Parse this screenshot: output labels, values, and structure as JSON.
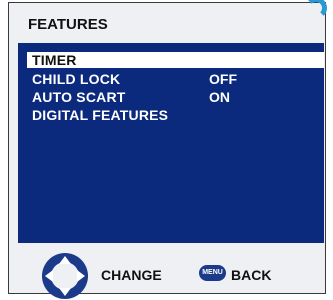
{
  "header": {
    "title": "FEATURES"
  },
  "menu": {
    "items": [
      {
        "label": "TIMER",
        "value": ""
      },
      {
        "label": "CHILD LOCK",
        "value": "OFF"
      },
      {
        "label": "AUTO SCART",
        "value": "ON"
      },
      {
        "label": "DIGITAL FEATURES",
        "value": ""
      }
    ],
    "selected_index": 0
  },
  "footer": {
    "change_label": "CHANGE",
    "menu_button_label": "MENU",
    "back_label": "BACK"
  },
  "colors": {
    "panel": "#0b2a7e",
    "frame": "#eef0f3",
    "accent": "#2a9ad6",
    "menu_badge": "#1c3a8a"
  },
  "icons": {
    "dpad": "navigation-dpad-icon",
    "menu": "menu-button-icon"
  }
}
